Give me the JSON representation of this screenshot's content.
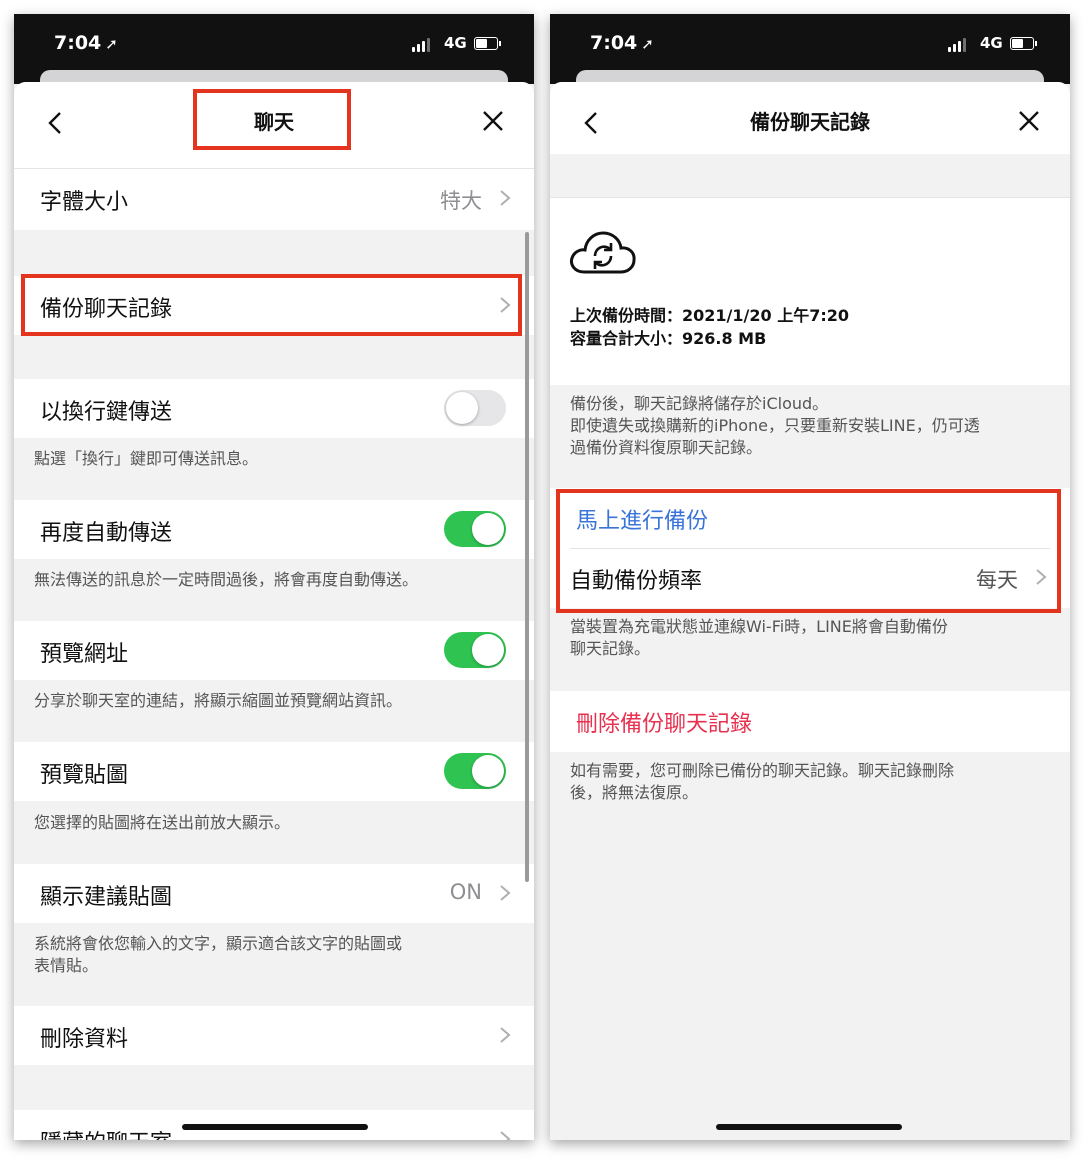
{
  "left": {
    "status": {
      "time": "7:04",
      "network": "4G"
    },
    "nav": {
      "title": "聊天"
    },
    "rows": {
      "font_size": {
        "label": "字體大小",
        "value": "特大"
      },
      "backup": {
        "label": "備份聊天記錄"
      },
      "enter_send": {
        "label": "以換行鍵傳送",
        "on": false,
        "desc": "點選「換行」鍵即可傳送訊息。"
      },
      "auto_resend": {
        "label": "再度自動傳送",
        "on": true,
        "desc": "無法傳送的訊息於一定時間過後，將會再度自動傳送。"
      },
      "url_preview": {
        "label": "預覽網址",
        "on": true,
        "desc": "分享於聊天室的連結，將顯示縮圖並預覽網站資訊。"
      },
      "sticker_preview": {
        "label": "預覽貼圖",
        "on": true,
        "desc": "您選擇的貼圖將在送出前放大顯示。"
      },
      "suggest_sticker": {
        "label": "顯示建議貼圖",
        "value": "ON",
        "desc1": "系統將會依您輸入的文字，顯示適合該文字的貼圖或",
        "desc2": "表情貼。"
      },
      "delete_data": {
        "label": "刪除資料"
      },
      "hidden_chats": {
        "label": "隱藏的聊天室"
      }
    }
  },
  "right": {
    "status": {
      "time": "7:04",
      "network": "4G"
    },
    "nav": {
      "title": "備份聊天記錄"
    },
    "info": {
      "last_backup": "上次備份時間：2021/1/20 上午7:20",
      "total_size": "容量合計大小：926.8 MB"
    },
    "desc1": {
      "line1": "備份後，聊天記錄將儲存於iCloud。",
      "line2": "即使遺失或換購新的iPhone，只要重新安裝LINE，仍可透",
      "line3": "過備份資料復原聊天記錄。"
    },
    "backup_now": {
      "label": "馬上進行備份"
    },
    "auto_freq": {
      "label": "自動備份頻率",
      "value": "每天"
    },
    "desc2": {
      "line1": "當裝置為充電狀態並連線Wi-Fi時，LINE將會自動備份",
      "line2": "聊天記錄。"
    },
    "delete_backup": {
      "label": "刪除備份聊天記錄"
    },
    "desc3": {
      "line1": "如有需要，您可刪除已備份的聊天記錄。聊天記錄刪除",
      "line2": "後，將無法復原。"
    }
  },
  "colors": {
    "highlight": "#e5341d",
    "toggle_on": "#2fc452",
    "link_blue": "#3a74d8",
    "destructive": "#e8304f"
  },
  "icons": [
    "back-chevron-icon",
    "close-x-icon",
    "chevron-right-icon",
    "cloud-sync-icon",
    "location-arrow-icon",
    "signal-icon",
    "battery-icon"
  ]
}
